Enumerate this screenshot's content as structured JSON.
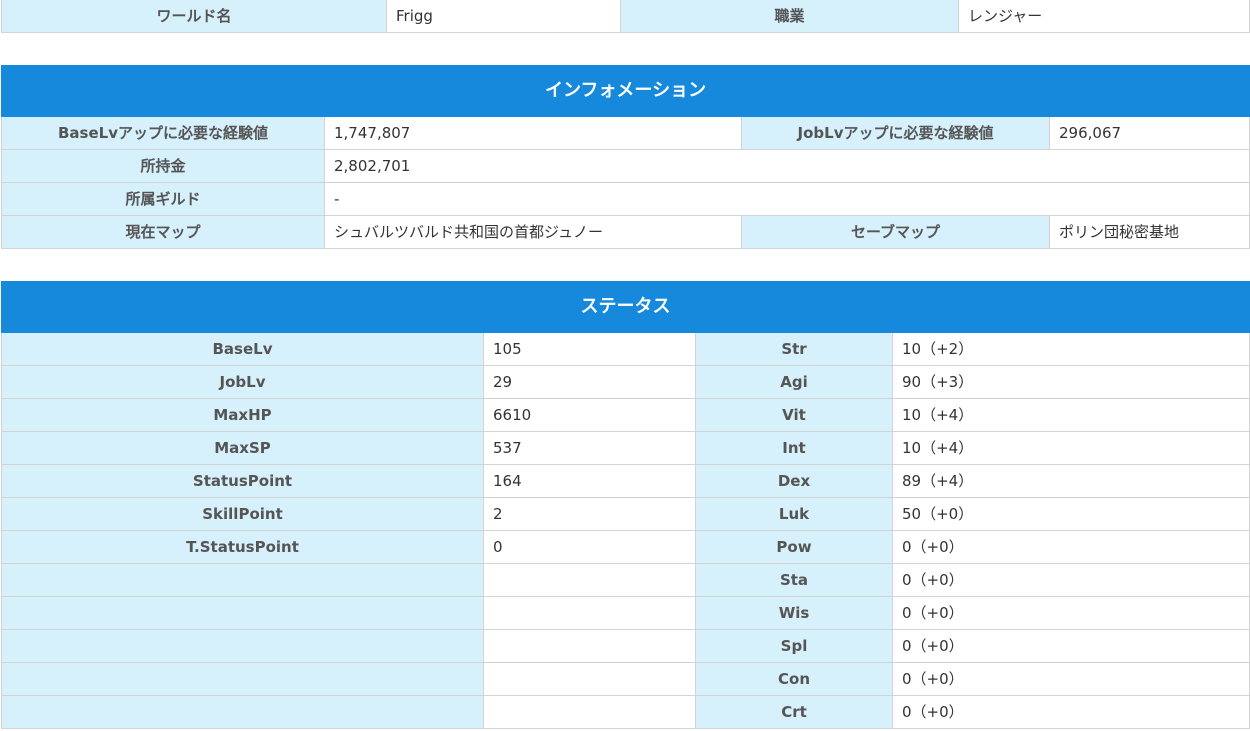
{
  "world": {
    "world_label": "ワールド名",
    "world_value": "Frigg",
    "job_label": "職業",
    "job_value": "レンジャー"
  },
  "info": {
    "title": "インフォメーション",
    "base_exp_label": "BaseLvアップに必要な経験値",
    "base_exp_value": "1,747,807",
    "job_exp_label": "JobLvアップに必要な経験値",
    "job_exp_value": "296,067",
    "zeny_label": "所持金",
    "zeny_value": "2,802,701",
    "guild_label": "所属ギルド",
    "guild_value": "-",
    "map_label": "現在マップ",
    "map_value": "シュバルツバルド共和国の首都ジュノー",
    "save_label": "セーブマップ",
    "save_value": "ポリン団秘密基地"
  },
  "status": {
    "title": "ステータス",
    "rows": [
      {
        "left_label": "BaseLv",
        "left_value": "105",
        "right_label": "Str",
        "right_value": "10（+2）"
      },
      {
        "left_label": "JobLv",
        "left_value": "29",
        "right_label": "Agi",
        "right_value": "90（+3）"
      },
      {
        "left_label": "MaxHP",
        "left_value": "6610",
        "right_label": "Vit",
        "right_value": "10（+4）"
      },
      {
        "left_label": "MaxSP",
        "left_value": "537",
        "right_label": "Int",
        "right_value": "10（+4）"
      },
      {
        "left_label": "StatusPoint",
        "left_value": "164",
        "right_label": "Dex",
        "right_value": "89（+4）"
      },
      {
        "left_label": "SkillPoint",
        "left_value": "2",
        "right_label": "Luk",
        "right_value": "50（+0）"
      },
      {
        "left_label": "T.StatusPoint",
        "left_value": "0",
        "right_label": "Pow",
        "right_value": "0（+0）"
      },
      {
        "left_label": "",
        "left_value": "",
        "right_label": "Sta",
        "right_value": "0（+0）"
      },
      {
        "left_label": "",
        "left_value": "",
        "right_label": "Wis",
        "right_value": "0（+0）"
      },
      {
        "left_label": "",
        "left_value": "",
        "right_label": "Spl",
        "right_value": "0（+0）"
      },
      {
        "left_label": "",
        "left_value": "",
        "right_label": "Con",
        "right_value": "0（+0）"
      },
      {
        "left_label": "",
        "left_value": "",
        "right_label": "Crt",
        "right_value": "0（+0）"
      }
    ]
  }
}
